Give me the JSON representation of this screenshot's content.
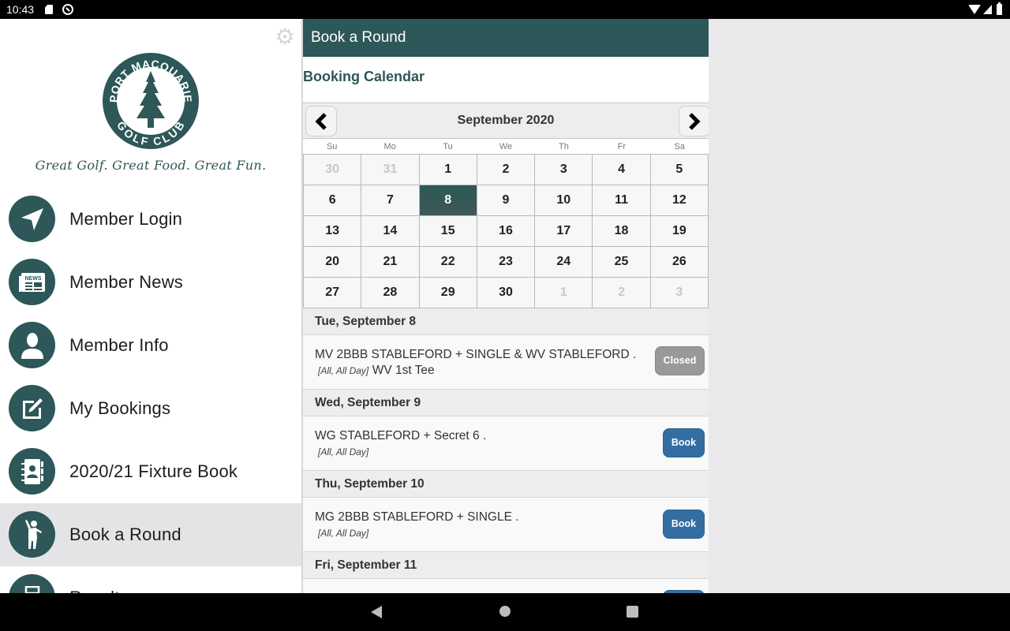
{
  "status_bar": {
    "time": "10:43",
    "icons": [
      "sd-card-icon",
      "do-not-disturb-icon",
      "wifi-icon",
      "signal-icon",
      "battery-icon"
    ]
  },
  "drawer": {
    "settings_icon": "gear-icon",
    "logo": {
      "top_text": "PORT MACQUARIE",
      "bottom_text": "GOLF CLUB",
      "color": "#2d5758"
    },
    "tagline": "Great Golf. Great Food. Great Fun.",
    "items": [
      {
        "label": "Member Login",
        "icon": "navigation-arrow-icon",
        "active": false
      },
      {
        "label": "Member News",
        "icon": "newspaper-icon",
        "active": false
      },
      {
        "label": "Member Info",
        "icon": "person-icon",
        "active": false
      },
      {
        "label": "My Bookings",
        "icon": "edit-pencil-icon",
        "active": false
      },
      {
        "label": "2020/21 Fixture Book",
        "icon": "contact-book-icon",
        "active": false
      },
      {
        "label": "Book a Round",
        "icon": "golfer-icon",
        "active": true
      },
      {
        "label": "Results",
        "icon": "printer-icon",
        "active": false
      }
    ]
  },
  "main": {
    "header_title": "Book a Round",
    "section_title": "Booking Calendar",
    "calendar": {
      "month_label": "September 2020",
      "prev_icon": "chevron-left-icon",
      "next_icon": "chevron-right-icon",
      "weekdays": [
        "Su",
        "Mo",
        "Tu",
        "We",
        "Th",
        "Fr",
        "Sa"
      ],
      "weeks": [
        [
          {
            "d": "30",
            "other": true
          },
          {
            "d": "31",
            "other": true
          },
          {
            "d": "1"
          },
          {
            "d": "2"
          },
          {
            "d": "3"
          },
          {
            "d": "4"
          },
          {
            "d": "5"
          }
        ],
        [
          {
            "d": "6"
          },
          {
            "d": "7"
          },
          {
            "d": "8",
            "selected": true
          },
          {
            "d": "9"
          },
          {
            "d": "10"
          },
          {
            "d": "11"
          },
          {
            "d": "12"
          }
        ],
        [
          {
            "d": "13"
          },
          {
            "d": "14"
          },
          {
            "d": "15"
          },
          {
            "d": "16"
          },
          {
            "d": "17"
          },
          {
            "d": "18"
          },
          {
            "d": "19"
          }
        ],
        [
          {
            "d": "20"
          },
          {
            "d": "21"
          },
          {
            "d": "22"
          },
          {
            "d": "23"
          },
          {
            "d": "24"
          },
          {
            "d": "25"
          },
          {
            "d": "26"
          }
        ],
        [
          {
            "d": "27"
          },
          {
            "d": "28"
          },
          {
            "d": "29"
          },
          {
            "d": "30"
          },
          {
            "d": "1",
            "other": true
          },
          {
            "d": "2",
            "other": true
          },
          {
            "d": "3",
            "other": true
          }
        ]
      ],
      "selected_date": "8"
    },
    "events": [
      {
        "date_label": "Tue, September 8",
        "title": "MV 2BBB STABLEFORD + SINGLE & WV STABLEFORD .",
        "meta": "[All, All Day]",
        "location": "WV 1st Tee",
        "button_label": "Closed",
        "button_state": "closed"
      },
      {
        "date_label": "Wed, September 9",
        "title": "WG STABLEFORD + Secret 6 .",
        "meta": "[All, All Day]",
        "location": "",
        "button_label": "Book",
        "button_state": "book"
      },
      {
        "date_label": "Thu, September 10",
        "title": "MG 2BBB STABLEFORD + SINGLE .",
        "meta": "[All, All Day]",
        "location": "",
        "button_label": "Book",
        "button_state": "book"
      },
      {
        "date_label": "Fri, September 11",
        "title": "",
        "meta": "",
        "location": "",
        "button_label": "",
        "button_state": "book"
      }
    ]
  },
  "colors": {
    "brand": "#2d5758",
    "book_button": "#336ea3",
    "closed_button": "#999999",
    "active_menu_bg": "#e4e4e6"
  },
  "nav_bar": {
    "icons": [
      "back-icon",
      "home-icon",
      "recent-apps-icon"
    ]
  }
}
